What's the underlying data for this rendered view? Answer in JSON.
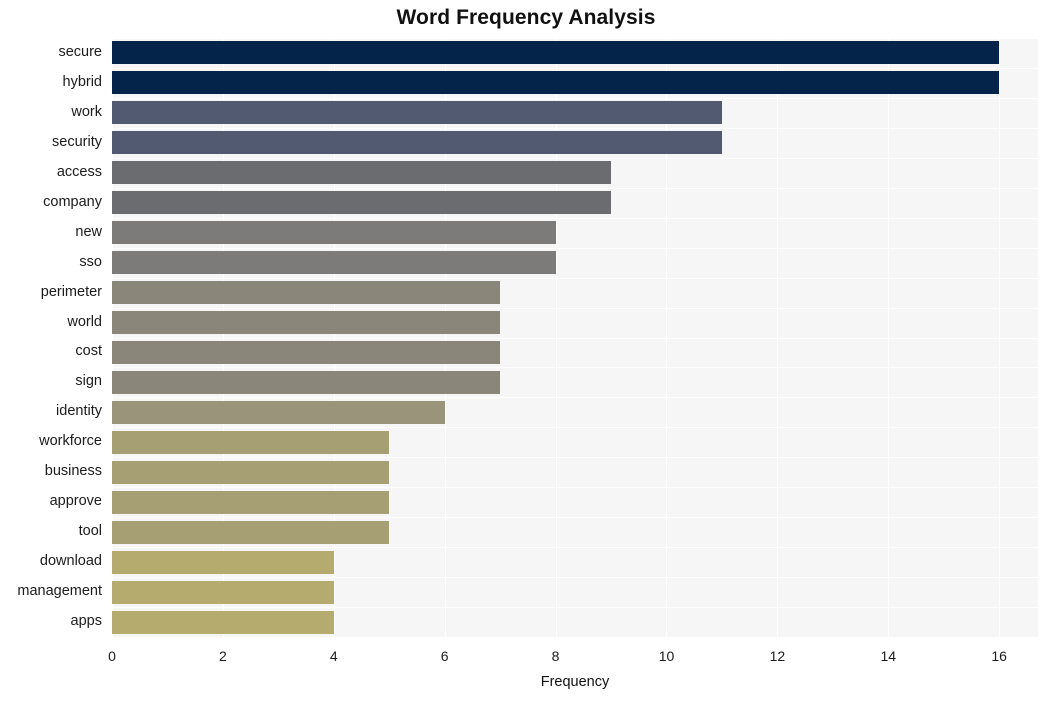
{
  "chart_data": {
    "type": "bar",
    "orientation": "horizontal",
    "title": "Word Frequency Analysis",
    "xlabel": "Frequency",
    "ylabel": "",
    "categories": [
      "secure",
      "hybrid",
      "work",
      "security",
      "access",
      "company",
      "new",
      "sso",
      "perimeter",
      "world",
      "cost",
      "sign",
      "identity",
      "workforce",
      "business",
      "approve",
      "tool",
      "download",
      "management",
      "apps"
    ],
    "values": [
      16,
      16,
      11,
      11,
      9,
      9,
      8,
      8,
      7,
      7,
      7,
      7,
      6,
      5,
      5,
      5,
      5,
      4,
      4,
      4
    ],
    "bar_colors": [
      "#042449",
      "#042449",
      "#525a72",
      "#525a72",
      "#6b6c70",
      "#6b6c70",
      "#7c7b79",
      "#7c7b79",
      "#8a877a",
      "#8a877a",
      "#8a877a",
      "#8a877a",
      "#99947a",
      "#a79f74",
      "#a79f74",
      "#a79f74",
      "#a79f74",
      "#b6ab6e",
      "#b6ab6e",
      "#b6ab6e"
    ],
    "xlim": [
      0,
      16.7
    ],
    "xticks": [
      0,
      2,
      4,
      6,
      8,
      10,
      12,
      14,
      16
    ],
    "xtick_labels": [
      "0",
      "2",
      "4",
      "6",
      "8",
      "10",
      "12",
      "14",
      "16"
    ],
    "grid": true,
    "grid_color": "#ffffff",
    "plot_background": "#f6f6f7",
    "figure_background": "#ffffff",
    "legend": null
  }
}
